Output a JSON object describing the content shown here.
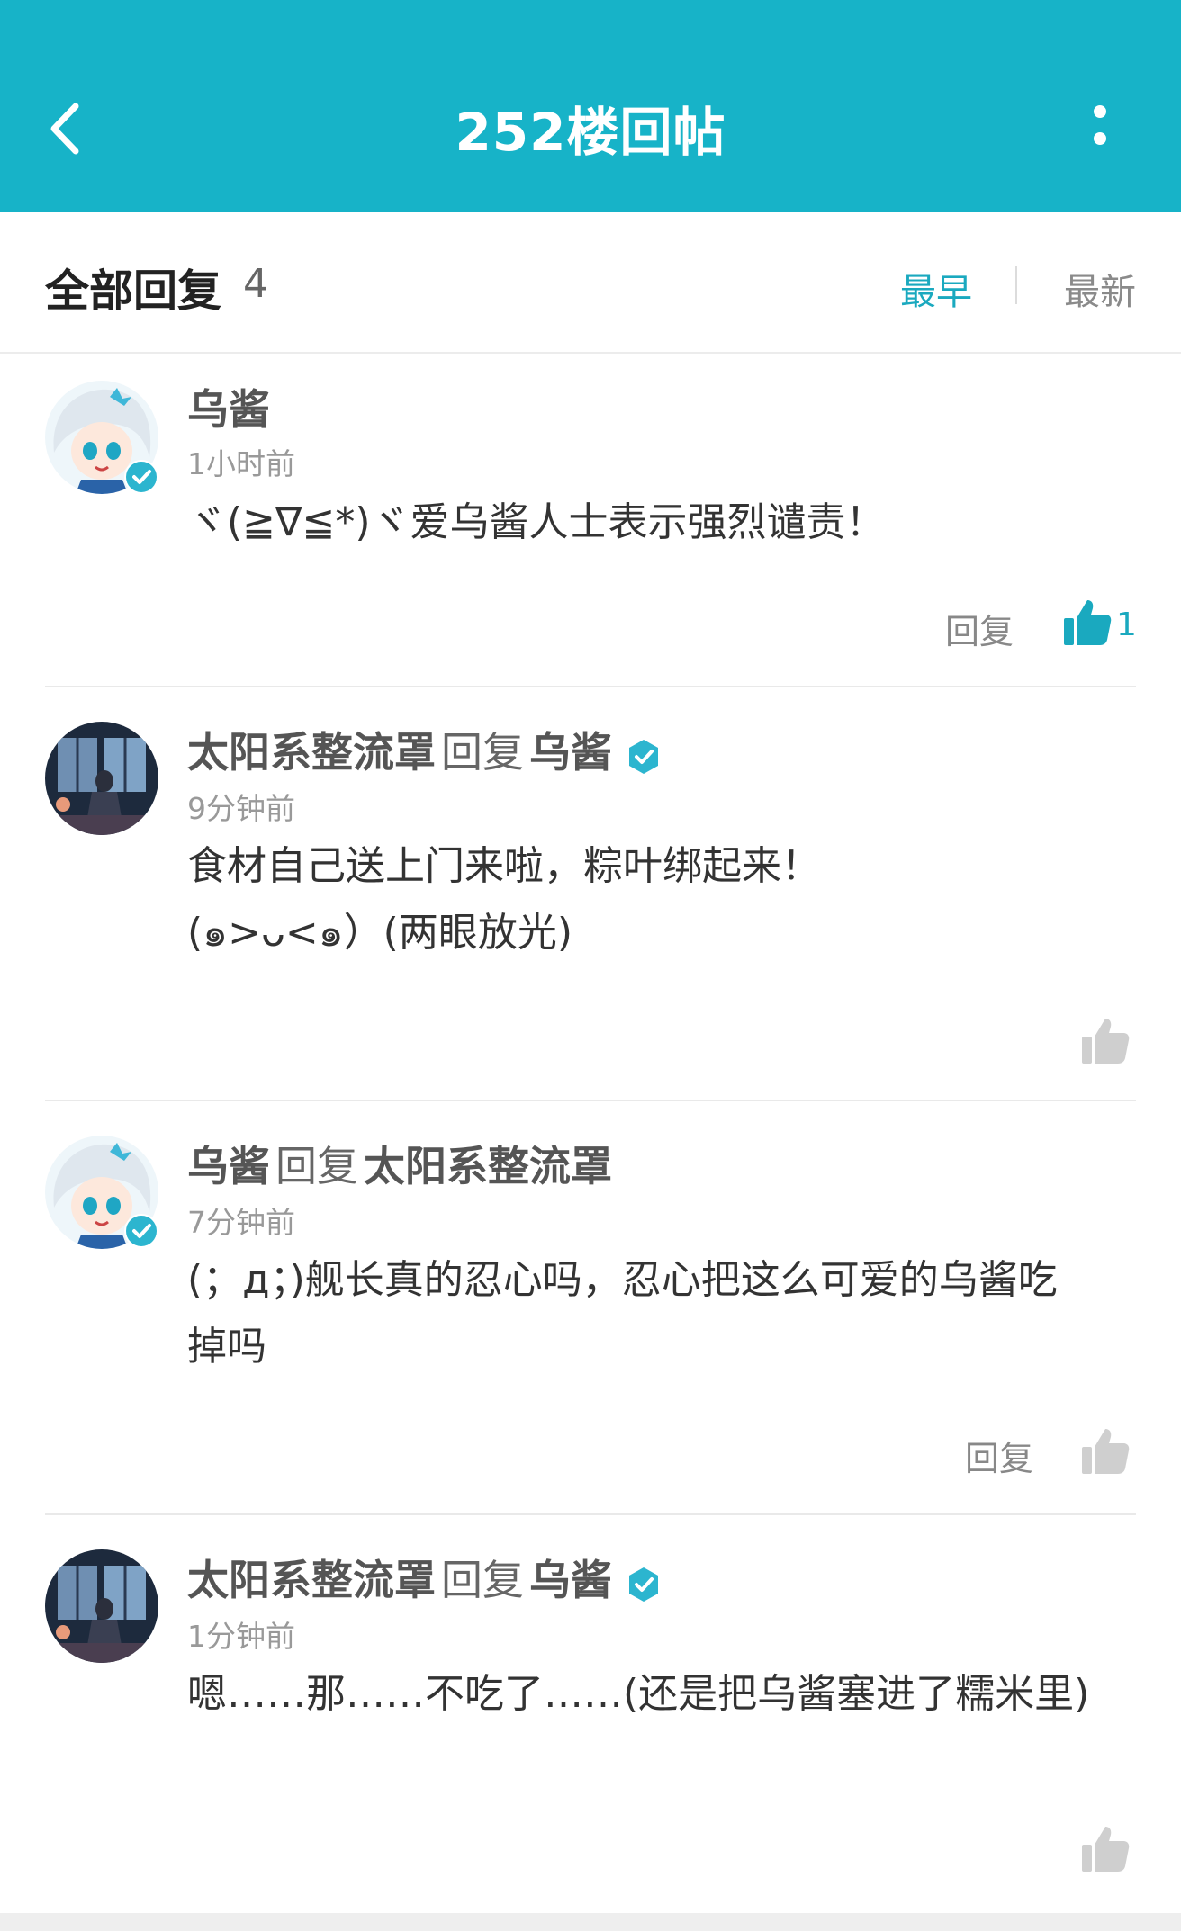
{
  "header": {
    "title": "252楼回帖"
  },
  "summary": {
    "label": "全部回复",
    "count": "4",
    "sort_earliest": "最早",
    "sort_latest": "最新"
  },
  "colors": {
    "accent": "#17b3c8",
    "active_sort": "#1aa9bf"
  },
  "replies": [
    {
      "author": "乌酱",
      "reply_word": "",
      "target": "",
      "time": "1小时前",
      "text": "ヾ(≧∇≦*)ヾ爱乌酱人士表示强烈谴责！",
      "reply_label": "回复",
      "likes": "1",
      "avatar": "anime-girl-avatar"
    },
    {
      "author": "太阳系整流罩",
      "reply_word": "回复",
      "target": "乌酱",
      "time": "9分钟前",
      "text_lines": [
        "食材自己送上门来啦，粽叶绑起来！",
        "(๑>ᴗ<๑）(两眼放光)"
      ],
      "avatar": "window-scene-avatar"
    },
    {
      "author": "乌酱",
      "reply_word": "回复",
      "target": "太阳系整流罩",
      "time": "7分钟前",
      "text_lines": [
        "(；д；)舰长真的忍心吗，忍心把这么可爱的乌酱吃",
        "掉吗"
      ],
      "reply_label": "回复",
      "avatar": "anime-girl-avatar"
    },
    {
      "author": "太阳系整流罩",
      "reply_word": "回复",
      "target": "乌酱",
      "time": "1分钟前",
      "text": "嗯……那……不吃了……(还是把乌酱塞进了糯米里)",
      "avatar": "window-scene-avatar"
    }
  ]
}
